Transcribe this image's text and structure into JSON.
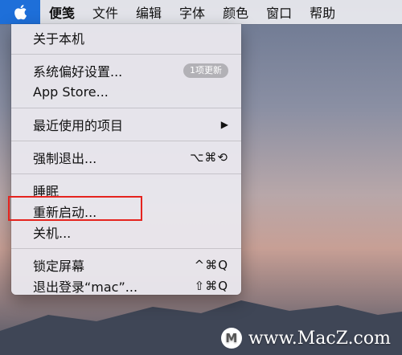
{
  "menubar": {
    "apple_icon": "apple-icon",
    "items": [
      "便笺",
      "文件",
      "编辑",
      "字体",
      "颜色",
      "窗口",
      "帮助"
    ],
    "accent_color": "#1e6fd9"
  },
  "apple_menu": {
    "about": "关于本机",
    "system_prefs": "系统偏好设置...",
    "update_badge": "1项更新",
    "app_store": "App Store...",
    "recent_items": "最近使用的项目",
    "submenu_arrow": "▶",
    "force_quit": "强制退出...",
    "force_quit_shortcut": "⌥⌘⟲",
    "sleep": "睡眠",
    "restart": "重新启动...",
    "shutdown": "关机...",
    "lock_screen": "锁定屏幕",
    "lock_shortcut": "^⌘Q",
    "logout": "退出登录“mac”...",
    "logout_shortcut": "⇧⌘Q"
  },
  "annotation": {
    "highlight_color": "#e5231e"
  },
  "watermark": {
    "text": "www.MacZ.com",
    "logo_letter": "M"
  }
}
